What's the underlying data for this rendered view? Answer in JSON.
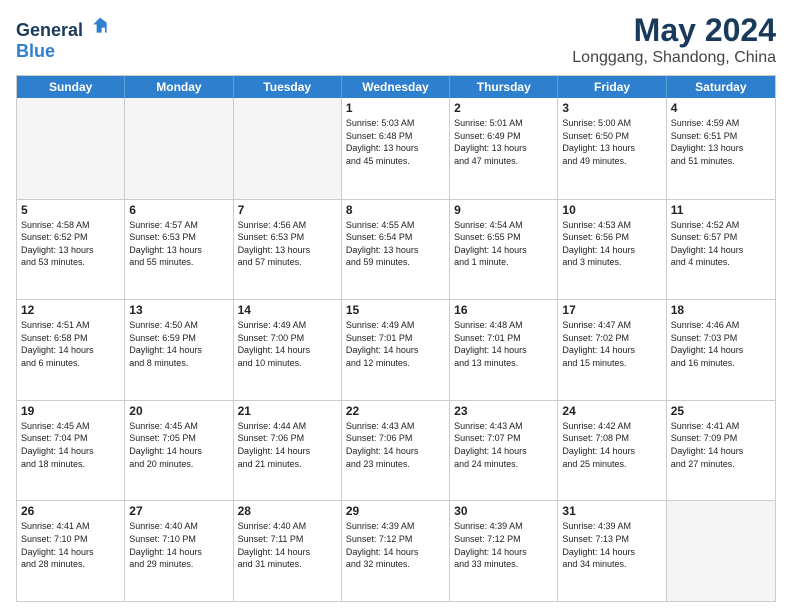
{
  "header": {
    "logo_line1": "General",
    "logo_line2": "Blue",
    "month": "May 2024",
    "location": "Longgang, Shandong, China"
  },
  "weekdays": [
    "Sunday",
    "Monday",
    "Tuesday",
    "Wednesday",
    "Thursday",
    "Friday",
    "Saturday"
  ],
  "rows": [
    [
      {
        "day": "",
        "info": "",
        "empty": true
      },
      {
        "day": "",
        "info": "",
        "empty": true
      },
      {
        "day": "",
        "info": "",
        "empty": true
      },
      {
        "day": "1",
        "info": "Sunrise: 5:03 AM\nSunset: 6:48 PM\nDaylight: 13 hours\nand 45 minutes."
      },
      {
        "day": "2",
        "info": "Sunrise: 5:01 AM\nSunset: 6:49 PM\nDaylight: 13 hours\nand 47 minutes."
      },
      {
        "day": "3",
        "info": "Sunrise: 5:00 AM\nSunset: 6:50 PM\nDaylight: 13 hours\nand 49 minutes."
      },
      {
        "day": "4",
        "info": "Sunrise: 4:59 AM\nSunset: 6:51 PM\nDaylight: 13 hours\nand 51 minutes."
      }
    ],
    [
      {
        "day": "5",
        "info": "Sunrise: 4:58 AM\nSunset: 6:52 PM\nDaylight: 13 hours\nand 53 minutes."
      },
      {
        "day": "6",
        "info": "Sunrise: 4:57 AM\nSunset: 6:53 PM\nDaylight: 13 hours\nand 55 minutes."
      },
      {
        "day": "7",
        "info": "Sunrise: 4:56 AM\nSunset: 6:53 PM\nDaylight: 13 hours\nand 57 minutes."
      },
      {
        "day": "8",
        "info": "Sunrise: 4:55 AM\nSunset: 6:54 PM\nDaylight: 13 hours\nand 59 minutes."
      },
      {
        "day": "9",
        "info": "Sunrise: 4:54 AM\nSunset: 6:55 PM\nDaylight: 14 hours\nand 1 minute."
      },
      {
        "day": "10",
        "info": "Sunrise: 4:53 AM\nSunset: 6:56 PM\nDaylight: 14 hours\nand 3 minutes."
      },
      {
        "day": "11",
        "info": "Sunrise: 4:52 AM\nSunset: 6:57 PM\nDaylight: 14 hours\nand 4 minutes."
      }
    ],
    [
      {
        "day": "12",
        "info": "Sunrise: 4:51 AM\nSunset: 6:58 PM\nDaylight: 14 hours\nand 6 minutes."
      },
      {
        "day": "13",
        "info": "Sunrise: 4:50 AM\nSunset: 6:59 PM\nDaylight: 14 hours\nand 8 minutes."
      },
      {
        "day": "14",
        "info": "Sunrise: 4:49 AM\nSunset: 7:00 PM\nDaylight: 14 hours\nand 10 minutes."
      },
      {
        "day": "15",
        "info": "Sunrise: 4:49 AM\nSunset: 7:01 PM\nDaylight: 14 hours\nand 12 minutes."
      },
      {
        "day": "16",
        "info": "Sunrise: 4:48 AM\nSunset: 7:01 PM\nDaylight: 14 hours\nand 13 minutes."
      },
      {
        "day": "17",
        "info": "Sunrise: 4:47 AM\nSunset: 7:02 PM\nDaylight: 14 hours\nand 15 minutes."
      },
      {
        "day": "18",
        "info": "Sunrise: 4:46 AM\nSunset: 7:03 PM\nDaylight: 14 hours\nand 16 minutes."
      }
    ],
    [
      {
        "day": "19",
        "info": "Sunrise: 4:45 AM\nSunset: 7:04 PM\nDaylight: 14 hours\nand 18 minutes."
      },
      {
        "day": "20",
        "info": "Sunrise: 4:45 AM\nSunset: 7:05 PM\nDaylight: 14 hours\nand 20 minutes."
      },
      {
        "day": "21",
        "info": "Sunrise: 4:44 AM\nSunset: 7:06 PM\nDaylight: 14 hours\nand 21 minutes."
      },
      {
        "day": "22",
        "info": "Sunrise: 4:43 AM\nSunset: 7:06 PM\nDaylight: 14 hours\nand 23 minutes."
      },
      {
        "day": "23",
        "info": "Sunrise: 4:43 AM\nSunset: 7:07 PM\nDaylight: 14 hours\nand 24 minutes."
      },
      {
        "day": "24",
        "info": "Sunrise: 4:42 AM\nSunset: 7:08 PM\nDaylight: 14 hours\nand 25 minutes."
      },
      {
        "day": "25",
        "info": "Sunrise: 4:41 AM\nSunset: 7:09 PM\nDaylight: 14 hours\nand 27 minutes."
      }
    ],
    [
      {
        "day": "26",
        "info": "Sunrise: 4:41 AM\nSunset: 7:10 PM\nDaylight: 14 hours\nand 28 minutes."
      },
      {
        "day": "27",
        "info": "Sunrise: 4:40 AM\nSunset: 7:10 PM\nDaylight: 14 hours\nand 29 minutes."
      },
      {
        "day": "28",
        "info": "Sunrise: 4:40 AM\nSunset: 7:11 PM\nDaylight: 14 hours\nand 31 minutes."
      },
      {
        "day": "29",
        "info": "Sunrise: 4:39 AM\nSunset: 7:12 PM\nDaylight: 14 hours\nand 32 minutes."
      },
      {
        "day": "30",
        "info": "Sunrise: 4:39 AM\nSunset: 7:12 PM\nDaylight: 14 hours\nand 33 minutes."
      },
      {
        "day": "31",
        "info": "Sunrise: 4:39 AM\nSunset: 7:13 PM\nDaylight: 14 hours\nand 34 minutes."
      },
      {
        "day": "",
        "info": "",
        "empty": true
      }
    ]
  ]
}
